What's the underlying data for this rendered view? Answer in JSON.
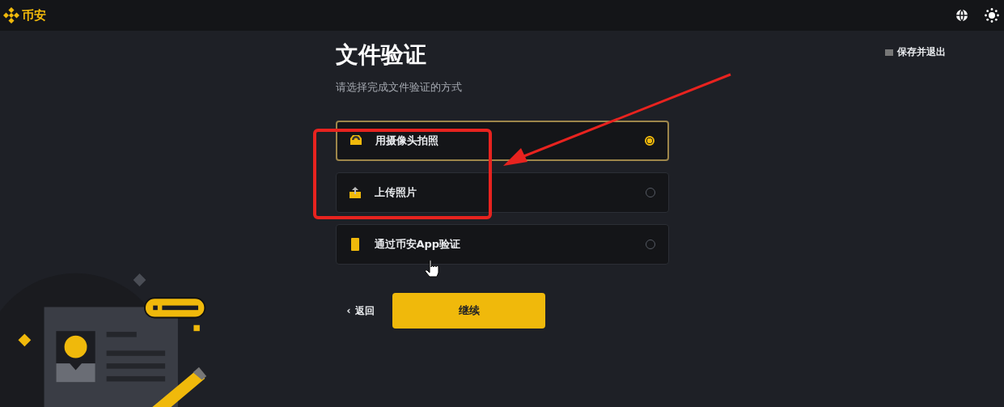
{
  "header": {
    "brand": "币安"
  },
  "save_exit": "保存并退出",
  "title": "文件验证",
  "subtitle": "请选择完成文件验证的方式",
  "options": [
    {
      "kind": "camera",
      "label": "用摄像头拍照",
      "selected": true
    },
    {
      "kind": "upload",
      "label": "上传照片",
      "selected": false
    },
    {
      "kind": "phone",
      "label": "通过币安App验证",
      "selected": false
    }
  ],
  "back": {
    "icon": "‹",
    "label": "返回"
  },
  "continue": "继续"
}
